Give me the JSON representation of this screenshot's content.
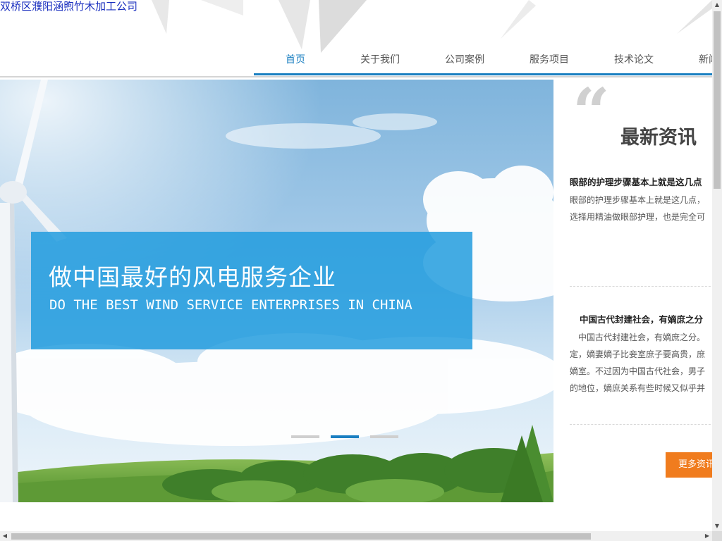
{
  "header": {
    "site_title": "双桥区濮阳涵煦竹木加工公司"
  },
  "nav": {
    "items": [
      {
        "label": "首页",
        "active": true
      },
      {
        "label": "关于我们",
        "active": false
      },
      {
        "label": "公司案例",
        "active": false
      },
      {
        "label": "服务项目",
        "active": false
      },
      {
        "label": "技术论文",
        "active": false
      },
      {
        "label": "新闻",
        "active": false
      }
    ]
  },
  "banner": {
    "title": "做中国最好的风电服务企业",
    "subtitle": "DO THE BEST WIND SERVICE ENTERPRISES IN CHINA",
    "slides": 3,
    "active_slide": 2
  },
  "news": {
    "quote_mark": "“",
    "heading": "最新资讯",
    "items": [
      {
        "title": "眼部的护理步骤基本上就是这几点",
        "lines": [
          "眼部的护理步骤基本上就是这几点，",
          "选择用精油做眼部护理，也是完全可"
        ]
      },
      {
        "title": "中国古代封建社会，有嫡庶之分",
        "lines": [
          "中国古代封建社会，有嫡庶之分。",
          "定，嫡妻嫡子比妾室庶子要高贵，庶",
          "嫡室。不过因为中国古代社会，男子",
          "的地位，嫡庶关系有些时候又似乎并"
        ]
      }
    ],
    "more_label": "更多资讯"
  },
  "scrollbars": {
    "up": "▲",
    "down": "▼",
    "left": "◀",
    "right": "▶"
  },
  "colors": {
    "accent": "#1a7fc1",
    "banner_box": "#229cde",
    "more_button": "#f07c1e",
    "site_title": "#1a2fbf"
  }
}
